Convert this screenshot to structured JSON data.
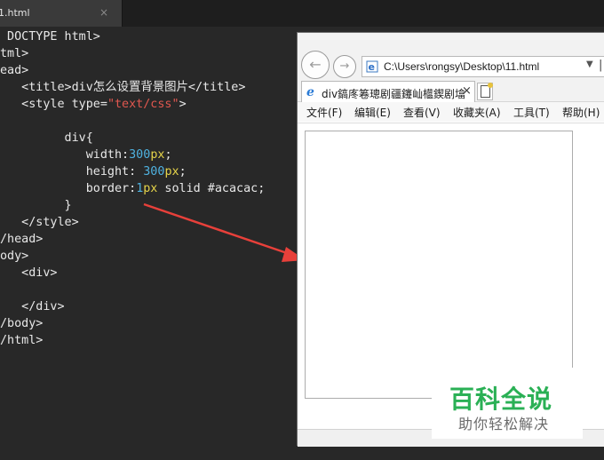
{
  "editor": {
    "tab": {
      "label": "1.html",
      "close": "×"
    },
    "lines": [
      {
        "segments": [
          {
            "text": " DOCTYPE html>",
            "cls": "t-tag"
          }
        ]
      },
      {
        "segments": [
          {
            "text": "tml>",
            "cls": "t-tag"
          }
        ]
      },
      {
        "segments": [
          {
            "text": "ead>",
            "cls": "t-tag"
          }
        ]
      },
      {
        "segments": [
          {
            "text": "   <title>div怎么设置背景图片</title>",
            "cls": "t-tag"
          }
        ]
      },
      {
        "segments": [
          {
            "text": "   <style type=",
            "cls": "t-attr"
          },
          {
            "text": "\"text/css\"",
            "cls": "t-str"
          },
          {
            "text": ">",
            "cls": "t-tag"
          }
        ]
      },
      {
        "segments": [
          {
            "text": "",
            "cls": "t-tag"
          }
        ]
      },
      {
        "segments": [
          {
            "text": "         div{",
            "cls": "t-tag"
          }
        ]
      },
      {
        "segments": [
          {
            "text": "            width:",
            "cls": "t-attr"
          },
          {
            "text": "300",
            "cls": "t-num"
          },
          {
            "text": "px",
            "cls": "t-unit"
          },
          {
            "text": ";",
            "cls": "t-tag"
          }
        ]
      },
      {
        "segments": [
          {
            "text": "            height: ",
            "cls": "t-attr"
          },
          {
            "text": "300",
            "cls": "t-num"
          },
          {
            "text": "px",
            "cls": "t-unit"
          },
          {
            "text": ";",
            "cls": "t-tag"
          }
        ]
      },
      {
        "segments": [
          {
            "text": "            border:",
            "cls": "t-attr"
          },
          {
            "text": "1",
            "cls": "t-num"
          },
          {
            "text": "px",
            "cls": "t-unit"
          },
          {
            "text": " solid #acacac;",
            "cls": "t-tag"
          }
        ]
      },
      {
        "segments": [
          {
            "text": "         }",
            "cls": "t-tag"
          }
        ]
      },
      {
        "segments": [
          {
            "text": "   </style>",
            "cls": "t-tag"
          }
        ]
      },
      {
        "segments": [
          {
            "text": "/head>",
            "cls": "t-tag"
          }
        ]
      },
      {
        "segments": [
          {
            "text": "ody>",
            "cls": "t-tag"
          }
        ]
      },
      {
        "segments": [
          {
            "text": "   <div>",
            "cls": "t-tag"
          }
        ]
      },
      {
        "segments": [
          {
            "text": "",
            "cls": "t-tag"
          }
        ]
      },
      {
        "segments": [
          {
            "text": "   </div>",
            "cls": "t-tag"
          }
        ]
      },
      {
        "segments": [
          {
            "text": "/body>",
            "cls": "t-tag"
          }
        ]
      },
      {
        "segments": [
          {
            "text": "/html>",
            "cls": "t-tag"
          }
        ]
      }
    ]
  },
  "browser": {
    "back_icon": "back-arrow-icon",
    "forward_icon": "forward-arrow-icon",
    "address": "C:\\Users\\rongsy\\Desktop\\11.html",
    "dropdown": "▼",
    "tab_title": "div鎬庝箞璁剧疆鑳屾櫙鍥剧墖",
    "tab_close": "×",
    "menu": [
      "文件(F)",
      "编辑(E)",
      "查看(V)",
      "收藏夹(A)",
      "工具(T)",
      "帮助(H)"
    ]
  },
  "watermark": {
    "title": "百科全说",
    "subtitle": "助你轻松解决"
  },
  "colors": {
    "editor_bg": "#282828",
    "string": "#e0574f",
    "number": "#4fb2e0",
    "unit": "#e6d44a",
    "arrow": "#e8403a",
    "watermark_green": "#2ab055"
  }
}
